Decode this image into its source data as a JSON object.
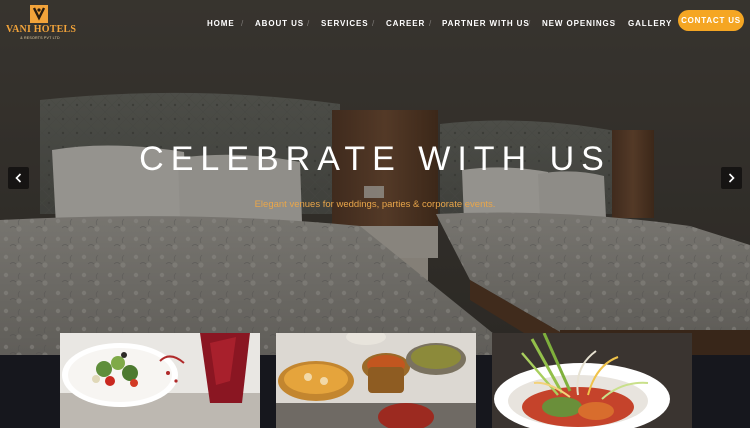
{
  "brand": {
    "name": "VANI HOTELS",
    "tagline": "& RESORTS PVT LTD",
    "accent_color": "#f5a623"
  },
  "nav": {
    "items": [
      "HOME",
      "ABOUT US",
      "SERVICES",
      "CAREER",
      "PARTNER WITH US",
      "NEW OPENINGS",
      "GALLERY"
    ],
    "separator": "/",
    "cta_label": "CONTACT US"
  },
  "hero": {
    "title": "CELEBRATE WITH US",
    "subtitle": "Elegant venues for weddings, parties & corporate events.",
    "prev_icon": "chevron-left-icon",
    "next_icon": "chevron-right-icon"
  },
  "cards": [
    {
      "icon": "salad-plate-image"
    },
    {
      "icon": "curry-bowls-image"
    },
    {
      "icon": "garnished-dish-image"
    }
  ]
}
